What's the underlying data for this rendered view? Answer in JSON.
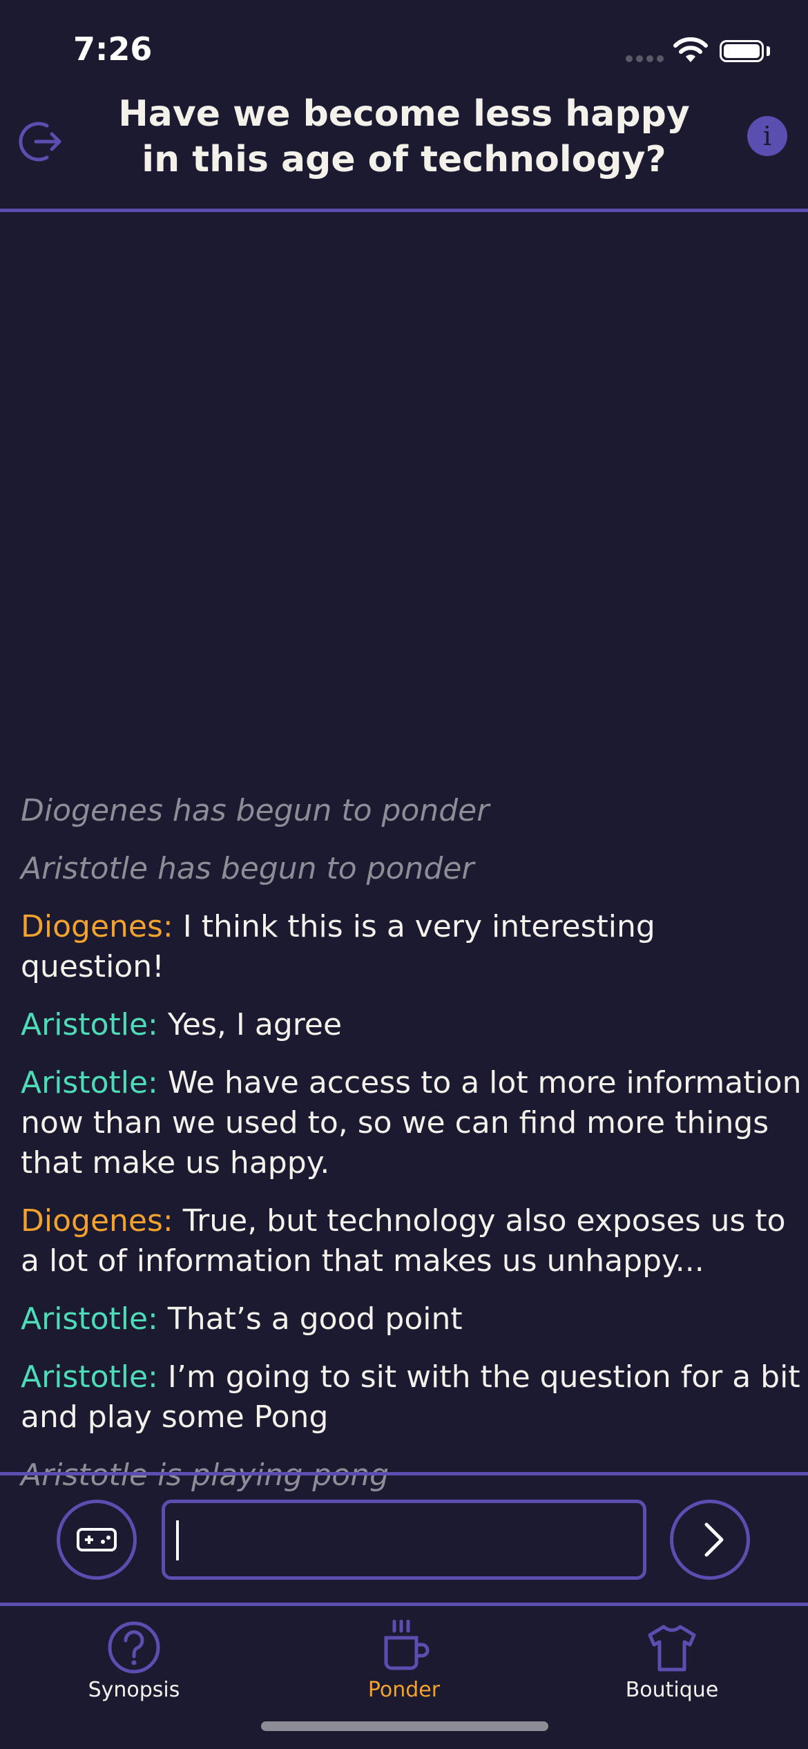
{
  "status": {
    "time": "7:26"
  },
  "header": {
    "title": "Have we become less happy in this age of technology?"
  },
  "chat": {
    "events": {
      "diogenes_ponder": "Diogenes has begun to ponder",
      "aristotle_ponder": "Aristotle has begun to ponder",
      "aristotle_pong": "Aristotle is playing pong"
    },
    "messages": [
      {
        "speaker": "Diogenes:",
        "text": "I think this is a very interesting question!"
      },
      {
        "speaker": "Aristotle:",
        "text": "Yes, I agree"
      },
      {
        "speaker": "Aristotle:",
        "text": "We have access to a lot more information now than we used to, so we can find more things that make us happy."
      },
      {
        "speaker": "Diogenes:",
        "text": "True, but technology also exposes us to a lot of information that makes us unhappy..."
      },
      {
        "speaker": "Aristotle:",
        "text": "That’s a good point"
      },
      {
        "speaker": "Aristotle:",
        "text": "I’m going to sit with the question for a bit and play some Pong"
      }
    ]
  },
  "composer": {
    "value": "",
    "placeholder": ""
  },
  "tabs": [
    {
      "label": "Synopsis",
      "icon": "question-circle-icon",
      "active": false
    },
    {
      "label": "Ponder",
      "icon": "coffee-cup-icon",
      "active": true
    },
    {
      "label": "Boutique",
      "icon": "tshirt-icon",
      "active": false
    }
  ],
  "colors": {
    "background": "#1b1a31",
    "accent": "#5a4fb0",
    "diogenes": "#f2a22d",
    "aristotle": "#4ddcb7",
    "event_text": "#8e8c96",
    "active_tab": "#f2a22d"
  }
}
